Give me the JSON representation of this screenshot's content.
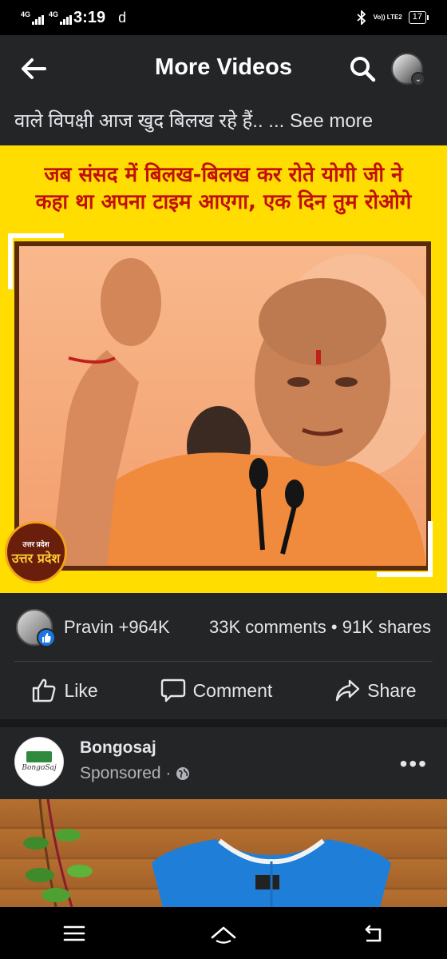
{
  "status_bar": {
    "net1": "4G",
    "net2": "4G",
    "time": "3:19",
    "dl_indicator": "d",
    "volte": "Vo)) LTE2",
    "battery": "17"
  },
  "appbar": {
    "title": "More Videos",
    "back_icon": "arrow-left-icon",
    "search_icon": "search-icon"
  },
  "caption": {
    "text": "वाले विपक्षी आज खुद बिलख रहे हैं.. ...",
    "see_more": "See more"
  },
  "post_image": {
    "headline_line1": "जब संसद में बिलख-बिलख कर रोते योगी जी ने",
    "headline_line2": "कहा था अपना टाइम आएगा, एक दिन तुम रोओगे",
    "badge_top": "उत्तर प्रदेश",
    "badge_main": "उत्तर प्रदेश"
  },
  "stats": {
    "reactions": "Pravin +964K",
    "comments_shares": "33K comments • 91K shares"
  },
  "actions": {
    "like": "Like",
    "comment": "Comment",
    "share": "Share"
  },
  "sponsored_post": {
    "brand_name": "Bongosaj",
    "logo_text": "BongoSaj",
    "sponsored_label": "Sponsored ·",
    "more_dots": "•••"
  },
  "colors": {
    "accent_blue": "#1b74e4",
    "poster_yellow": "#ffdd00",
    "headline_red": "#c0100c"
  }
}
